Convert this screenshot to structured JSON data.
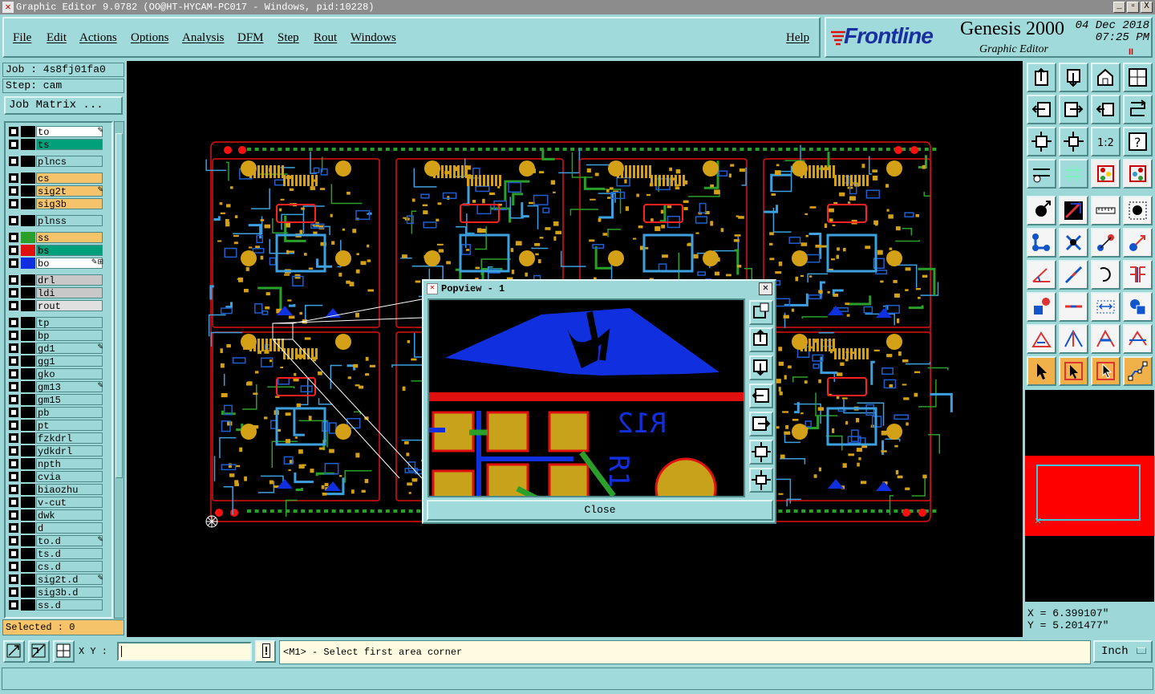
{
  "window": {
    "title": "Graphic Editor 9.0782 (OO@HT-HYCAM-PC017 - Windows, pid:10228)",
    "buttons": [
      "_",
      "▫",
      "X"
    ]
  },
  "menu": {
    "items": [
      "File",
      "Edit",
      "Actions",
      "Options",
      "Analysis",
      "DFM",
      "Step",
      "Rout",
      "Windows"
    ],
    "help": "Help"
  },
  "brand": {
    "logo": "Frontline",
    "product": "Genesis 2000",
    "subtitle": "Graphic Editor",
    "date": "04 Dec 2018",
    "time": "07:25 PM",
    "pause": "II"
  },
  "job": {
    "job_label": "Job : 4s8fj01fa0",
    "step_label": "Step: cam",
    "matrix_button": "Job Matrix ..."
  },
  "layers": [
    {
      "name": "to",
      "swatch": "#000000",
      "fill": "#ffffff",
      "mark": "pencil"
    },
    {
      "name": "ts",
      "swatch": "#000000",
      "fill": "#00a07a",
      "mark": ""
    },
    {
      "name": "plncs",
      "swatch": "#000000",
      "fill": "#9dd7d7",
      "mark": "",
      "gap": true
    },
    {
      "name": "cs",
      "swatch": "#000000",
      "fill": "#f5c36a",
      "mark": "",
      "gap": true
    },
    {
      "name": "sig2t",
      "swatch": "#000000",
      "fill": "#f5c36a",
      "mark": "pencil"
    },
    {
      "name": "sig3b",
      "swatch": "#000000",
      "fill": "#f5c36a",
      "mark": ""
    },
    {
      "name": "plnss",
      "swatch": "#000000",
      "fill": "#9dd7d7",
      "mark": "",
      "gap": true
    },
    {
      "name": "ss",
      "swatch": "#2aa02a",
      "fill": "#f5c36a",
      "mark": "",
      "gap": true
    },
    {
      "name": "bs",
      "swatch": "#e01010",
      "fill": "#00a07a",
      "mark": ""
    },
    {
      "name": "bo",
      "swatch": "#1030e0",
      "fill": "#ffffff",
      "mark": "pencil-grid"
    },
    {
      "name": "drl",
      "swatch": "#000000",
      "fill": "#c8c8c8",
      "mark": "",
      "gap": true
    },
    {
      "name": "ldi",
      "swatch": "#000000",
      "fill": "#c8c8c8",
      "mark": ""
    },
    {
      "name": "rout",
      "swatch": "#000000",
      "fill": "#e0e0e0",
      "mark": ""
    },
    {
      "name": "tp",
      "swatch": "#000000",
      "fill": "#9dd7d7",
      "mark": "",
      "gap": true
    },
    {
      "name": "bp",
      "swatch": "#000000",
      "fill": "#9dd7d7",
      "mark": ""
    },
    {
      "name": "gd1",
      "swatch": "#000000",
      "fill": "#9dd7d7",
      "mark": "pencil"
    },
    {
      "name": "gg1",
      "swatch": "#000000",
      "fill": "#9dd7d7",
      "mark": ""
    },
    {
      "name": "gko",
      "swatch": "#000000",
      "fill": "#9dd7d7",
      "mark": ""
    },
    {
      "name": "gm13",
      "swatch": "#000000",
      "fill": "#9dd7d7",
      "mark": "pencil"
    },
    {
      "name": "gm15",
      "swatch": "#000000",
      "fill": "#9dd7d7",
      "mark": ""
    },
    {
      "name": "pb",
      "swatch": "#000000",
      "fill": "#9dd7d7",
      "mark": ""
    },
    {
      "name": "pt",
      "swatch": "#000000",
      "fill": "#9dd7d7",
      "mark": ""
    },
    {
      "name": "fzkdrl",
      "swatch": "#000000",
      "fill": "#9dd7d7",
      "mark": ""
    },
    {
      "name": "ydkdrl",
      "swatch": "#000000",
      "fill": "#9dd7d7",
      "mark": ""
    },
    {
      "name": "npth",
      "swatch": "#000000",
      "fill": "#9dd7d7",
      "mark": ""
    },
    {
      "name": "cvia",
      "swatch": "#000000",
      "fill": "#9dd7d7",
      "mark": ""
    },
    {
      "name": "biaozhu",
      "swatch": "#000000",
      "fill": "#9dd7d7",
      "mark": ""
    },
    {
      "name": "v-cut",
      "swatch": "#000000",
      "fill": "#9dd7d7",
      "mark": ""
    },
    {
      "name": "dwk",
      "swatch": "#000000",
      "fill": "#9dd7d7",
      "mark": ""
    },
    {
      "name": "d",
      "swatch": "#000000",
      "fill": "#9dd7d7",
      "mark": ""
    },
    {
      "name": "to.d",
      "swatch": "#000000",
      "fill": "#9dd7d7",
      "mark": "pencil"
    },
    {
      "name": "ts.d",
      "swatch": "#000000",
      "fill": "#9dd7d7",
      "mark": ""
    },
    {
      "name": "cs.d",
      "swatch": "#000000",
      "fill": "#9dd7d7",
      "mark": ""
    },
    {
      "name": "sig2t.d",
      "swatch": "#000000",
      "fill": "#9dd7d7",
      "mark": "pencil"
    },
    {
      "name": "sig3b.d",
      "swatch": "#000000",
      "fill": "#9dd7d7",
      "mark": ""
    },
    {
      "name": "ss.d",
      "swatch": "#000000",
      "fill": "#9dd7d7",
      "mark": ""
    }
  ],
  "selected_label": "Selected : 0",
  "popview": {
    "title": "Popview - 1",
    "close_label": "Close"
  },
  "coords": {
    "x": "X = 6.399107\"",
    "y": "Y = 5.201477\""
  },
  "bottom": {
    "xy_label": "X Y :",
    "xy_value": "",
    "prompt": "<M1> - Select first area corner",
    "units": "Inch",
    "warning": "!"
  },
  "colors": {
    "background": "#9dd7d7",
    "canvas": "#000000",
    "board_outline": "#e01010",
    "copper": "#d4a017",
    "trace_blue": "#3da0e0",
    "trace_green": "#2aa02a",
    "overview_fill": "#ff0000"
  },
  "toolbar_icons": [
    "zoom-home-icon",
    "zoom-out-icon",
    "zoom-home-step-icon",
    "zoom-window-icon",
    "pan-left-icon",
    "pan-right-icon",
    "fit-icon",
    "flip-icon",
    "fit-screen-icon",
    "center-icon",
    "scale-1-2-icon",
    "help-icon",
    "measure-icon",
    "grid-icon",
    "layers-toggle-icon",
    "layers-select-icon",
    "snap-pad-icon",
    "snap-line-icon",
    "ruler-icon",
    "dot-icon",
    "select-net-icon",
    "cross-icon",
    "pad-to-pad-icon",
    "drag-pad-icon",
    "angle-icon",
    "line-slope-icon",
    "arc-icon",
    "fit-side-icon",
    "pad-select-icon",
    "line-mid-icon",
    "dimension-icon",
    "copy-shape-icon",
    "triangle-red-icon",
    "triangle-blue-icon",
    "triangle-both-icon",
    "triangle-fill-icon",
    "cursor-icon",
    "cursor-select-icon",
    "cursor-multi-icon",
    "route-icon"
  ]
}
